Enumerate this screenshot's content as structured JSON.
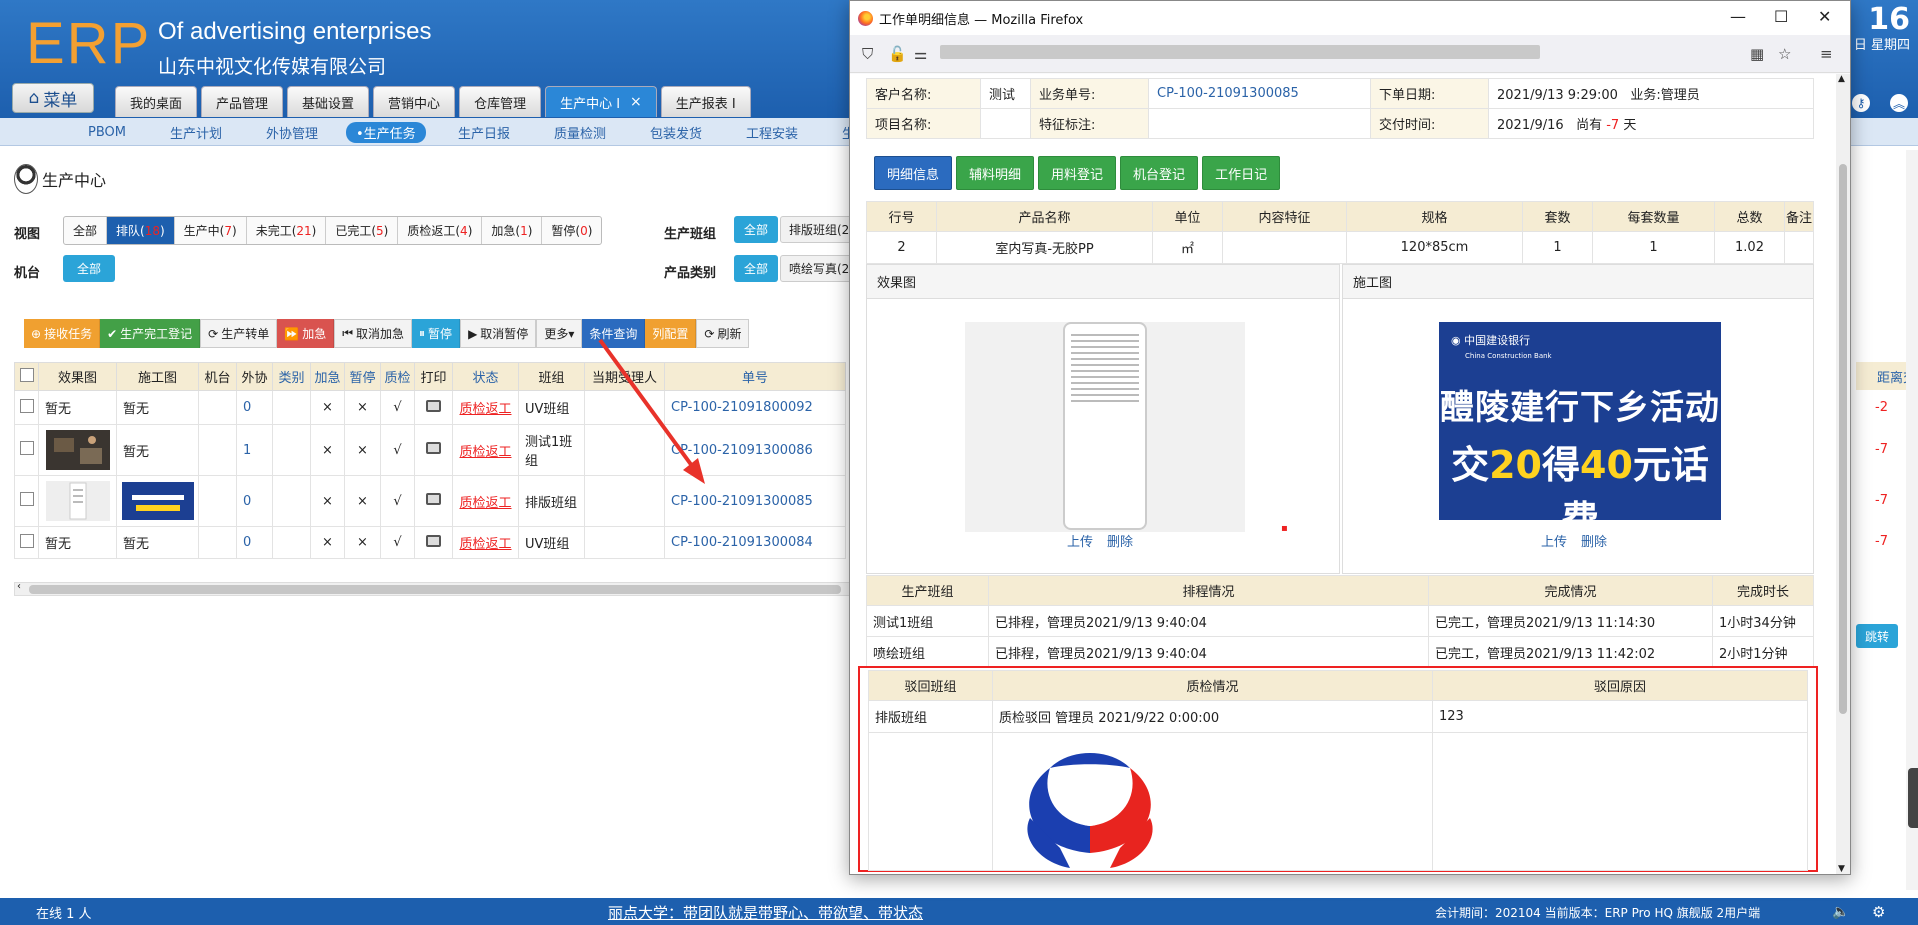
{
  "erp": {
    "logo": "ERP",
    "company_en": "Of advertising enterprises",
    "company_cn": "山东中视文化传媒有限公司",
    "clock": "16",
    "date": "日 星期四",
    "menu_label": "菜单"
  },
  "main_tabs": [
    {
      "label": "我的桌面"
    },
    {
      "label": "产品管理"
    },
    {
      "label": "基础设置"
    },
    {
      "label": "营销中心"
    },
    {
      "label": "仓库管理"
    },
    {
      "label": "生产中心 I",
      "close": "×"
    },
    {
      "label": "生产报表 I"
    }
  ],
  "sub_nav": [
    "PBOM",
    "生产计划",
    "外协管理",
    "•生产任务",
    "生产日报",
    "质量检测",
    "包装发货",
    "工程安装",
    "生"
  ],
  "page": {
    "title": "生产中心",
    "view_label": "视图",
    "machine_label": "机台",
    "team_label": "生产班组",
    "category_label": "产品类别",
    "view_filters": [
      {
        "label": "全部",
        "count": ""
      },
      {
        "label": "排队(",
        "count": "18",
        "suffix": ")"
      },
      {
        "label": "生产中(",
        "count": "7",
        "suffix": ")"
      },
      {
        "label": "未完工(",
        "count": "21",
        "suffix": ")"
      },
      {
        "label": "已完工(",
        "count": "5",
        "suffix": ")"
      },
      {
        "label": "质检返工(",
        "count": "4",
        "suffix": ")"
      },
      {
        "label": "加急(",
        "count": "1",
        "suffix": ")"
      },
      {
        "label": "暂停(",
        "count": "0",
        "suffix": ")"
      }
    ],
    "machine_all": "全部",
    "team_all": "全部",
    "team_partial": "排版班组(2",
    "category_all": "全部",
    "category_partial": "喷绘写真(2"
  },
  "toolbar": [
    {
      "label": "接收任务",
      "icon": "⊕",
      "style": "tb-orange"
    },
    {
      "label": "生产完工登记",
      "icon": "✔",
      "style": "tb-green"
    },
    {
      "label": "生产转单",
      "icon": "⟳",
      "style": "tb-light"
    },
    {
      "label": "加急",
      "icon": "⏩",
      "style": "tb-red"
    },
    {
      "label": "取消加急",
      "icon": "⏮",
      "style": "tb-light"
    },
    {
      "label": "暂停",
      "icon": "⏸",
      "style": "tb-cyan"
    },
    {
      "label": "取消暂停",
      "icon": "▶",
      "style": "tb-light"
    },
    {
      "label": "更多▾",
      "icon": "",
      "style": "tb-light"
    },
    {
      "label": "条件查询",
      "icon": "",
      "style": "tb-blue"
    },
    {
      "label": "列配置",
      "icon": "",
      "style": "tb-orange"
    },
    {
      "label": "刷新",
      "icon": "⟳",
      "style": "tb-light"
    }
  ],
  "grid": {
    "headers": [
      "效果图",
      "施工图",
      "机台",
      "外协",
      "类别",
      "加急",
      "暂停",
      "质检",
      "打印",
      "状态",
      "班组",
      "当期受理人",
      "单号"
    ],
    "right_header": "距离交",
    "rows": [
      {
        "effect": "暂无",
        "construct": "暂无",
        "outsource": "0",
        "urgent": "×",
        "pause": "×",
        "qc": "√",
        "status": "质检返工",
        "team": "UV班组",
        "order": "CP-100-21091800092",
        "due": "-2"
      },
      {
        "effect": "",
        "construct": "暂无",
        "outsource": "1",
        "urgent": "×",
        "pause": "×",
        "qc": "√",
        "status": "质检返工",
        "team": "测试1班组",
        "order": "CP-100-21091300086",
        "due": "-7"
      },
      {
        "effect": "",
        "construct": "",
        "outsource": "0",
        "urgent": "×",
        "pause": "×",
        "qc": "√",
        "status": "质检返工",
        "team": "排版班组",
        "order": "CP-100-21091300085",
        "due": "-7"
      },
      {
        "effect": "暂无",
        "construct": "暂无",
        "outsource": "0",
        "urgent": "×",
        "pause": "×",
        "qc": "√",
        "status": "质检返工",
        "team": "UV班组",
        "order": "CP-100-21091300084",
        "due": "-7"
      }
    ],
    "jump": "跳转"
  },
  "status_bar": {
    "online": "在线  1  人",
    "marquee": "丽点大学：带团队就是带野心、带欲望、带状态",
    "right": "会计期间：202104 当前版本：ERP Pro HQ 旗舰版 2用户端"
  },
  "popup": {
    "window_title": "工作单明细信息 — Mozilla Firefox",
    "info": {
      "customer_k": "客户名称:",
      "customer_v": "测试",
      "bizno_k": "业务单号:",
      "bizno_v": "CP-100-21091300085",
      "orderdate_k": "下单日期:",
      "orderdate_v": "2021/9/13 9:29:00",
      "biz_k": "业务:",
      "biz_v": "管理员",
      "project_k": "项目名称:",
      "project_v": "",
      "feature_k": "特征标注:",
      "feature_v": "",
      "delivery_k": "交付时间:",
      "delivery_v": "2021/9/16",
      "remain_pre": "尚有",
      "remain_num": "-7",
      "remain_post": "天"
    },
    "tabs": [
      "明细信息",
      "辅料明细",
      "用料登记",
      "机台登记",
      "工作日记"
    ],
    "detail_headers": [
      "行号",
      "产品名称",
      "单位",
      "内容特征",
      "规格",
      "套数",
      "每套数量",
      "总数",
      "备注"
    ],
    "detail_rows": [
      [
        "2",
        "室内写真-无胶PP",
        "㎡",
        "",
        "120*85cm",
        "1",
        "1",
        "1.02",
        ""
      ]
    ],
    "effect_title": "效果图",
    "construct_title": "施工图",
    "upload": "上传",
    "delete": "删除",
    "banner": {
      "bank": "中国建设银行",
      "bank_en": "China Construction Bank",
      "line1": "醴陵建行下乡活动",
      "line2_a": "交",
      "line2_b": "20",
      "line2_c": "得",
      "line2_d": "40",
      "line2_e": "元话费"
    },
    "plan_headers": [
      "生产班组",
      "排程情况",
      "完成情况",
      "完成时长"
    ],
    "plan_rows": [
      [
        "测试1班组",
        "已排程，管理员2021/9/13 9:40:04",
        "已完工，管理员2021/9/13 11:14:30",
        "1小时34分钟"
      ],
      [
        "喷绘班组",
        "已排程，管理员2021/9/13 9:40:04",
        "已完工，管理员2021/9/13 11:42:02",
        "2小时1分钟"
      ]
    ],
    "reject_headers": [
      "驳回班组",
      "质检情况",
      "驳回原因"
    ],
    "reject_rows": [
      [
        "排版班组",
        "质检驳回 管理员 2021/9/22 0:00:00",
        "123"
      ]
    ]
  }
}
